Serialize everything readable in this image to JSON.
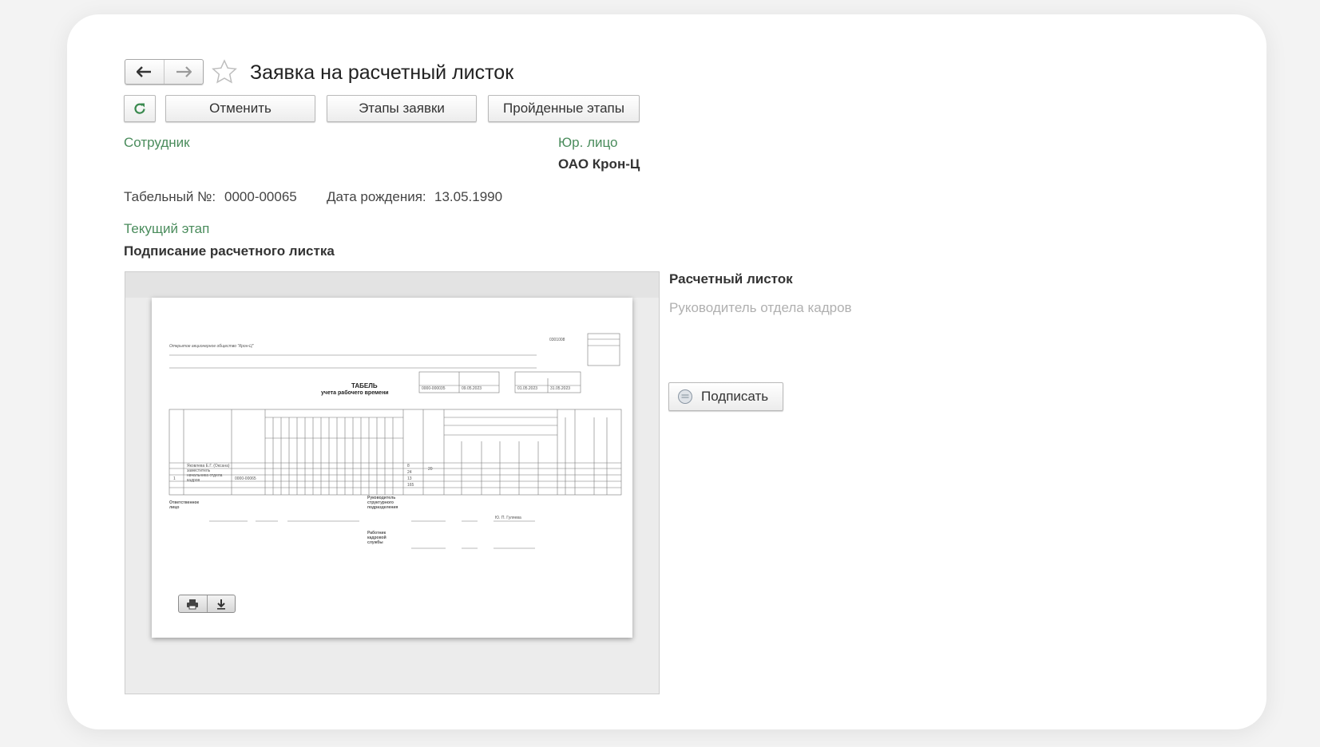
{
  "window": {
    "title": "Заявка на расчетный листок"
  },
  "toolbar": {
    "cancel_label": "Отменить",
    "stages_label": "Этапы заявки",
    "passed_stages_label": "Пройденные этапы"
  },
  "employee": {
    "label": "Сотрудник"
  },
  "legal_entity": {
    "label": "Юр. лицо",
    "value": "ОАО Крон-Ц"
  },
  "details": {
    "tab_no_label": "Табельный №:",
    "tab_no_value": "0000-00065",
    "birth_label": "Дата рождения:",
    "birth_value": "13.05.1990"
  },
  "stage": {
    "label": "Текущий этап",
    "value": "Подписание расчетного листка"
  },
  "side": {
    "heading": "Расчетный листок",
    "subheading": "Руководитель отдела кадров",
    "sign_label": "Подписать"
  },
  "document": {
    "org": "Открытое акционерное общество \"Крон-Ц\"",
    "title_line1": "ТАБЕЛЬ",
    "title_line2": "учета рабочего времени",
    "doc_number": "0000-000035",
    "doc_date": "09.05.2023",
    "period_from": "01.05.2023",
    "period_to": "31.05.2023",
    "okud": "0301008",
    "row_no": "1",
    "row_name": "Яковлева Е.Г. (Оксана) заместитель начальника отдела кадров",
    "row_tab": "0000-00065",
    "hours": [
      "8",
      "24",
      "13",
      "165"
    ],
    "days": [
      "20"
    ],
    "footer_responsible": "Ответственное лицо",
    "footer_head": "Руководитель структурного подразделения",
    "footer_hr": "Работник кадровой службы",
    "footer_name": "Ю. П. Гуляева"
  },
  "icons": {
    "back": "arrow-left-icon",
    "forward": "arrow-right-icon",
    "favorite": "star-icon",
    "refresh": "refresh-icon",
    "sign": "sign-icon",
    "print": "printer-icon",
    "download": "download-icon"
  },
  "colors": {
    "accent_green": "#4a8c5c",
    "background": "#f3f3f3",
    "card": "#ffffff"
  }
}
